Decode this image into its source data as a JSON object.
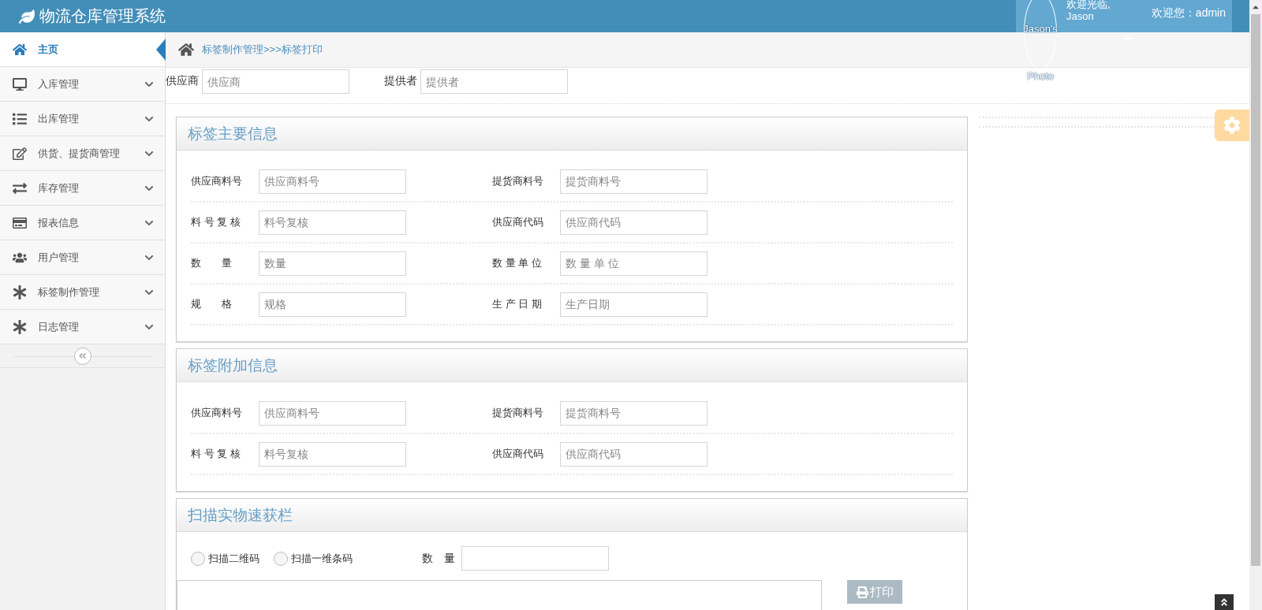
{
  "header": {
    "title": "物流仓库管理系统",
    "avatar_alt": "Jason's Photo",
    "greeting": "欢迎光临,",
    "user_name": "Jason",
    "welcome": "欢迎您：admin"
  },
  "sidebar": {
    "items": [
      {
        "label": "主页",
        "selected": true,
        "expandable": false
      },
      {
        "label": "入库管理",
        "selected": false,
        "expandable": true
      },
      {
        "label": "出库管理",
        "selected": false,
        "expandable": true
      },
      {
        "label": "供货、提货商管理",
        "selected": false,
        "expandable": true
      },
      {
        "label": "库存管理",
        "selected": false,
        "expandable": true
      },
      {
        "label": "报表信息",
        "selected": false,
        "expandable": true
      },
      {
        "label": "用户管理",
        "selected": false,
        "expandable": true
      },
      {
        "label": "标签制作管理",
        "selected": false,
        "expandable": true
      },
      {
        "label": "日志管理",
        "selected": false,
        "expandable": true
      }
    ]
  },
  "breadcrumb": "标签制作管理>>>标签打印",
  "filters": [
    {
      "label": "供应商",
      "placeholder": "供应商"
    },
    {
      "label": "提供者",
      "placeholder": "提供者"
    }
  ],
  "panels": [
    {
      "title": "标签主要信息",
      "fields": [
        {
          "label": "供应商料号",
          "placeholder": "供应商料号"
        },
        {
          "label": "提货商料号",
          "placeholder": "提货商料号"
        },
        {
          "label": "料 号 复 核",
          "placeholder": "料号复核"
        },
        {
          "label": "供应商代码",
          "placeholder": "供应商代码"
        },
        {
          "label": "数　　量",
          "placeholder": "数量"
        },
        {
          "label": "数 量 单 位",
          "placeholder": "数 量 单 位"
        },
        {
          "label": "规　　格",
          "placeholder": "规格"
        },
        {
          "label": "生 产 日 期",
          "placeholder": "生产日期"
        }
      ]
    },
    {
      "title": "标签附加信息",
      "fields": [
        {
          "label": "供应商料号",
          "placeholder": "供应商料号"
        },
        {
          "label": "提货商料号",
          "placeholder": "提货商料号"
        },
        {
          "label": "料 号 复 核",
          "placeholder": "料号复核"
        },
        {
          "label": "供应商代码",
          "placeholder": "供应商代码"
        }
      ]
    }
  ],
  "scan": {
    "title": "扫描实物速获栏",
    "options": [
      {
        "label": "扫描二维码",
        "selected": false
      },
      {
        "label": "扫描一维条码",
        "selected": false
      }
    ],
    "quantity_label": "数　量",
    "print_button": "打印"
  }
}
